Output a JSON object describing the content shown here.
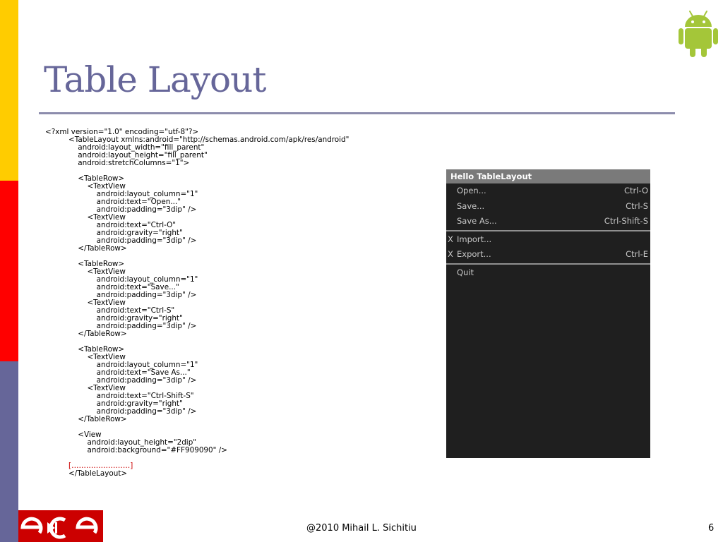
{
  "slide": {
    "title": "Table Layout",
    "colors": {
      "bar_top": "#ffcc00",
      "bar_middle": "#ff0000",
      "bar_bottom": "#666699",
      "title": "#666699",
      "rule": "#8c8cac",
      "android_green": "#a4c639",
      "logo_red": "#cc0000"
    }
  },
  "code": {
    "lines": [
      {
        "text": "<?xml version=\"1.0\" encoding=\"utf-8\"?>"
      },
      {
        "text": "          <TableLayout xmlns:android=\"http://schemas.android.com/apk/res/android\""
      },
      {
        "text": "              android:layout_width=\"fill_parent\""
      },
      {
        "text": "              android:layout_height=\"fill_parent\""
      },
      {
        "text": "              android:stretchColumns=\"1\">"
      },
      {
        "text": ""
      },
      {
        "text": "              <TableRow>"
      },
      {
        "text": "                  <TextView"
      },
      {
        "text": "                      android:layout_column=\"1\""
      },
      {
        "text": "                      android:text=\"Open...\""
      },
      {
        "text": "                      android:padding=\"3dip\" />"
      },
      {
        "text": "                  <TextView"
      },
      {
        "text": "                      android:text=\"Ctrl-O\""
      },
      {
        "text": "                      android:gravity=\"right\""
      },
      {
        "text": "                      android:padding=\"3dip\" />"
      },
      {
        "text": "              </TableRow>"
      },
      {
        "text": ""
      },
      {
        "text": "              <TableRow>"
      },
      {
        "text": "                  <TextView"
      },
      {
        "text": "                      android:layout_column=\"1\""
      },
      {
        "text": "                      android:text=\"Save...\""
      },
      {
        "text": "                      android:padding=\"3dip\" />"
      },
      {
        "text": "                  <TextView"
      },
      {
        "text": "                      android:text=\"Ctrl-S\""
      },
      {
        "text": "                      android:gravity=\"right\""
      },
      {
        "text": "                      android:padding=\"3dip\" />"
      },
      {
        "text": "              </TableRow>"
      },
      {
        "text": ""
      },
      {
        "text": "              <TableRow>"
      },
      {
        "text": "                  <TextView"
      },
      {
        "text": "                      android:layout_column=\"1\""
      },
      {
        "text": "                      android:text=\"Save As...\""
      },
      {
        "text": "                      android:padding=\"3dip\" />"
      },
      {
        "text": "                  <TextView"
      },
      {
        "text": "                      android:text=\"Ctrl-Shift-S\""
      },
      {
        "text": "                      android:gravity=\"right\""
      },
      {
        "text": "                      android:padding=\"3dip\" />"
      },
      {
        "text": "              </TableRow>"
      },
      {
        "text": ""
      },
      {
        "text": "              <View"
      },
      {
        "text": "                  android:layout_height=\"2dip\""
      },
      {
        "text": "                  android:background=\"#FF909090\" />"
      },
      {
        "text": ""
      },
      {
        "text": "          [……………………]",
        "red": true
      },
      {
        "text": "          </TableLayout>"
      }
    ]
  },
  "phone": {
    "title": "Hello TableLayout",
    "groups": [
      [
        {
          "mark": "",
          "label": "Open...",
          "shortcut": "Ctrl-O"
        },
        {
          "mark": "",
          "label": "Save...",
          "shortcut": "Ctrl-S"
        },
        {
          "mark": "",
          "label": "Save As...",
          "shortcut": "Ctrl-Shift-S"
        }
      ],
      [
        {
          "mark": "X",
          "label": "Import...",
          "shortcut": ""
        },
        {
          "mark": "X",
          "label": "Export...",
          "shortcut": "Ctrl-E"
        }
      ],
      [
        {
          "mark": "",
          "label": "Quit",
          "shortcut": ""
        }
      ]
    ]
  },
  "footer": {
    "logo_text": "ece",
    "credit": "@2010 Mihail L. Sichitiu",
    "page_number": "6"
  }
}
